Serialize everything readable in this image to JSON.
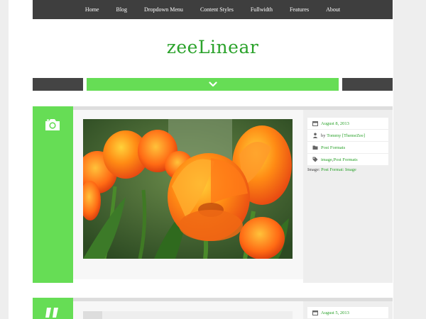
{
  "nav": {
    "items": [
      "Home",
      "Blog",
      "Dropdown Menu",
      "Content Styles",
      "Fullwidth",
      "Features",
      "About"
    ]
  },
  "site": {
    "title": "zeeLinear"
  },
  "colors": {
    "accent": "#66dd55",
    "link": "#2aa22a",
    "dark": "#3e3e3e"
  },
  "post1": {
    "icon": "camera-icon",
    "date": "August 8, 2013",
    "author_prefix": "by",
    "author": "Tommy [ThemeZee]",
    "category": "Post Formats",
    "tag_1": "image",
    "tag_sep": ", ",
    "tag_2": "Post Formats",
    "caption_prefix": "Image:",
    "caption_link": "Post Format: Image"
  },
  "post2": {
    "icon": "quote-icon",
    "date": "August 5, 2013"
  }
}
